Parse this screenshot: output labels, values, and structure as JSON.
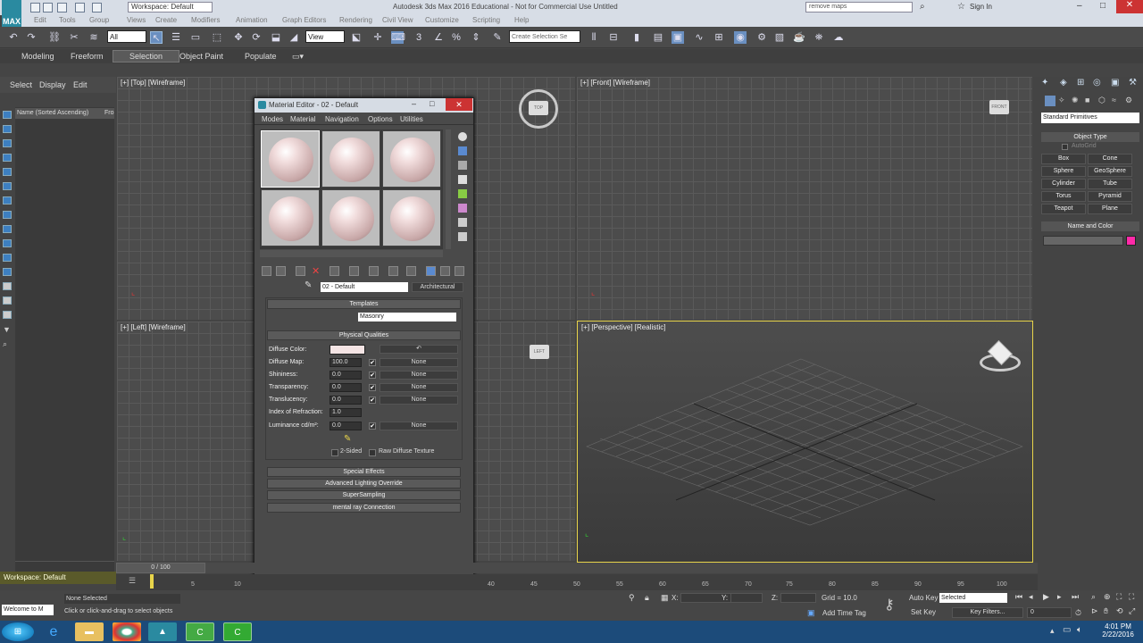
{
  "titlebar": {
    "workspace": "Workspace: Default",
    "title": "Autodesk 3ds Max 2016 Educational - Not for Commercial Use   Untitled",
    "search_placeholder": "remove maps",
    "sign_in": "Sign In"
  },
  "app_logo": "MAX",
  "menubar": [
    "Edit",
    "Tools",
    "Group",
    "Views",
    "Create",
    "Modifiers",
    "Animation",
    "Graph Editors",
    "Rendering",
    "Civil View",
    "Customize",
    "Scripting",
    "Help"
  ],
  "toolbar": {
    "selection_filter": "All",
    "ref_coord": "View",
    "named_selection": "Create Selection Se"
  },
  "ribbon": {
    "tabs": [
      "Modeling",
      "Freeform",
      "Selection",
      "Object Paint",
      "Populate"
    ],
    "active": "Selection"
  },
  "scene_explorer": {
    "tabs": [
      "Select",
      "Display",
      "Edit"
    ],
    "column_name": "Name (Sorted Ascending)",
    "column_fro": "Fro"
  },
  "viewports": {
    "top": "[+] [Top] [Wireframe]",
    "front": "[+] [Front] [Wireframe]",
    "left": "[+] [Left] [Wireframe]",
    "perspective": "[+] [Perspective] [Realistic]"
  },
  "viewcube_labels": {
    "top": "TOP",
    "front": "FRONT",
    "left": "LEFT"
  },
  "command_panel": {
    "category": "Standard Primitives",
    "object_type_header": "Object Type",
    "autogrid": "AutoGrid",
    "buttons": [
      "Box",
      "Cone",
      "Sphere",
      "GeoSphere",
      "Cylinder",
      "Tube",
      "Torus",
      "Pyramid",
      "Teapot",
      "Plane"
    ],
    "name_color_header": "Name and Color",
    "color": "#ff2aa8"
  },
  "material_editor": {
    "title": "Material Editor - 02 - Default",
    "menus": [
      "Modes",
      "Material",
      "Navigation",
      "Options",
      "Utilities"
    ],
    "material_name": "02 - Default",
    "material_type": "Architectural",
    "templates_header": "Templates",
    "template_value": "Masonry",
    "physical_header": "Physical Qualities",
    "rows": [
      {
        "label": "Diffuse Map:",
        "value": "100.0",
        "map": "None"
      },
      {
        "label": "Shininess:",
        "value": "0.0",
        "map": "None"
      },
      {
        "label": "Transparency:",
        "value": "0.0",
        "map": "None"
      },
      {
        "label": "Translucency:",
        "value": "0.0",
        "map": "None"
      },
      {
        "label": "Index of Refraction:",
        "value": "1.0"
      },
      {
        "label": "Luminance cd/m²:",
        "value": "0.0",
        "map": "None"
      }
    ],
    "diffuse_label": "Diffuse Color:",
    "diffuse_color": "#f4e4e4",
    "two_sided": "2-Sided",
    "raw_diffuse": "Raw Diffuse Texture",
    "collapsed": [
      "Special Effects",
      "Advanced Lighting Override",
      "SuperSampling",
      "mental ray Connection"
    ]
  },
  "timeline": {
    "frame": "0 / 100",
    "ticks": [
      "5",
      "10",
      "40",
      "45",
      "50",
      "55",
      "60",
      "65",
      "70",
      "75",
      "80",
      "85",
      "90",
      "95",
      "100"
    ]
  },
  "status": {
    "workspace": "Workspace: Default",
    "selected": "None Selected",
    "prompt": "Click or click-and-drag to select objects",
    "welcome": "Welcome to M",
    "x_label": "X:",
    "y_label": "Y:",
    "z_label": "Z:",
    "grid": "Grid = 10.0",
    "add_time_tag": "Add Time Tag",
    "auto_key": "Auto Key",
    "set_key": "Set Key",
    "key_mode": "Selected",
    "key_filters": "Key Filters...",
    "frame_field": "0"
  },
  "taskbar": {
    "time": "4:01 PM",
    "date": "2/22/2016"
  }
}
